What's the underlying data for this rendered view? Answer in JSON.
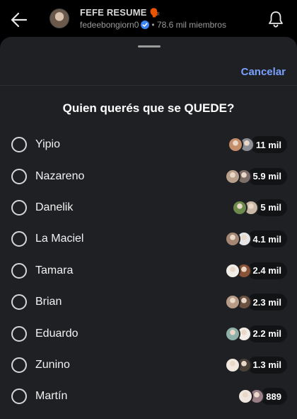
{
  "header": {
    "channel_name": "FEFE RESUME",
    "channel_emoji": "🗣️",
    "handle": "fedeebongiorn0",
    "members": "• 78.6 mil miembros"
  },
  "sheet": {
    "cancel_label": "Cancelar",
    "question": "Quien querés que se QUEDE?"
  },
  "options": [
    {
      "label": "Yipio",
      "votes": "11 mil",
      "avatar_colors": [
        "#c48d6a",
        "#8c8f95"
      ]
    },
    {
      "label": "Nazareno",
      "votes": "5.9 mil",
      "avatar_colors": [
        "#b9a08a",
        "#7d6e68"
      ]
    },
    {
      "label": "Danelik",
      "votes": "5 mil",
      "avatar_colors": [
        "#6b8a4c",
        "#c9b8a6"
      ]
    },
    {
      "label": "La Maciel",
      "votes": "4.1 mil",
      "avatar_colors": [
        "#a48672",
        "#e6e6e6"
      ]
    },
    {
      "label": "Tamara",
      "votes": "2.4 mil",
      "avatar_colors": [
        "#f1ede8",
        "#8a5236"
      ]
    },
    {
      "label": "Brian",
      "votes": "2.3 mil",
      "avatar_colors": [
        "#b79b86",
        "#6b5142"
      ]
    },
    {
      "label": "Eduardo",
      "votes": "2.2 mil",
      "avatar_colors": [
        "#8fb0a8",
        "#f4ece6"
      ]
    },
    {
      "label": "Zunino",
      "votes": "1.3 mil",
      "avatar_colors": [
        "#f2e8e0",
        "#4a4038"
      ]
    },
    {
      "label": "Martín",
      "votes": "889",
      "avatar_colors": [
        "#f0e6e0",
        "#9a7e86"
      ]
    }
  ]
}
